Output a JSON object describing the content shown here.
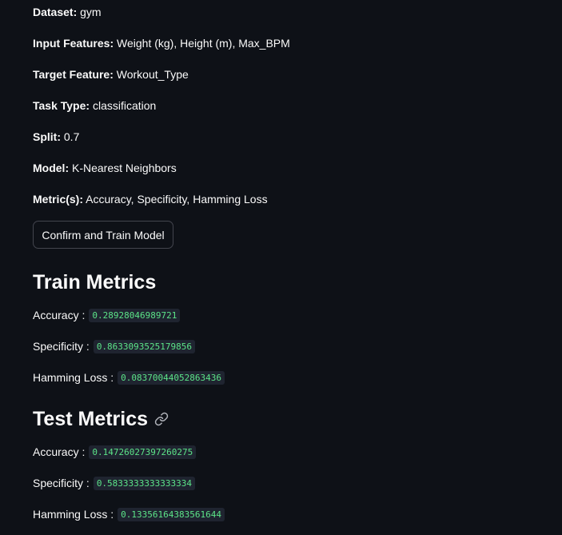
{
  "config": {
    "dataset": {
      "label": "Dataset:",
      "value": "gym"
    },
    "input_features": {
      "label": "Input Features:",
      "value": "Weight (kg), Height (m), Max_BPM"
    },
    "target_feature": {
      "label": "Target Feature:",
      "value": "Workout_Type"
    },
    "task_type": {
      "label": "Task Type:",
      "value": "classification"
    },
    "split": {
      "label": "Split:",
      "value": "0.7"
    },
    "model": {
      "label": "Model:",
      "value": "K-Nearest Neighbors"
    },
    "metrics": {
      "label": "Metric(s):",
      "value": "Accuracy, Specificity, Hamming Loss"
    }
  },
  "confirm_button": {
    "label": "Confirm and Train Model"
  },
  "train": {
    "title": "Train Metrics",
    "metrics": [
      {
        "label": "Accuracy :",
        "value": "0.28928046989721"
      },
      {
        "label": "Specificity :",
        "value": "0.8633093525179856"
      },
      {
        "label": "Hamming Loss :",
        "value": "0.08370044052863436"
      }
    ]
  },
  "test": {
    "title": "Test Metrics",
    "link_icon": "link-icon",
    "metrics": [
      {
        "label": "Accuracy :",
        "value": "0.14726027397260275"
      },
      {
        "label": "Specificity :",
        "value": "0.5833333333333334"
      },
      {
        "label": "Hamming Loss :",
        "value": "0.13356164383561644"
      }
    ]
  },
  "colors": {
    "background": "#0e1117",
    "text": "#fafafa",
    "code_text": "#5ce488",
    "code_bg": "#1f2430",
    "button_border": "#43454e"
  }
}
